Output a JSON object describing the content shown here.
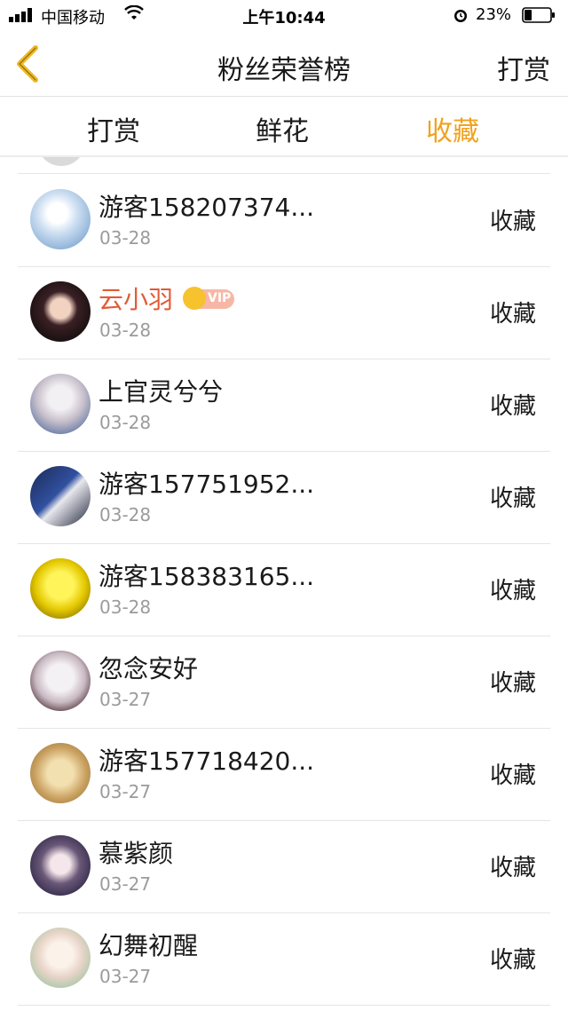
{
  "status_bar": {
    "carrier": "中国移动",
    "time": "上午10:44",
    "battery": "23%"
  },
  "nav": {
    "title": "粉丝荣誉榜",
    "right_action": "打赏",
    "back_icon": "chevron-left-icon"
  },
  "tabs": [
    {
      "label": "打赏",
      "active": false
    },
    {
      "label": "鲜花",
      "active": false
    },
    {
      "label": "收藏",
      "active": true
    }
  ],
  "colors": {
    "accent": "#f0a21e",
    "vip_name": "#e35a36",
    "secondary_text": "#9b9b9b"
  },
  "rows": [
    {
      "name": "游客158207374...",
      "date": "03-28",
      "action": "收藏",
      "vip": false
    },
    {
      "name": "云小羽",
      "date": "03-28",
      "action": "收藏",
      "vip": true,
      "badge": "VIP"
    },
    {
      "name": "上官灵兮兮",
      "date": "03-28",
      "action": "收藏",
      "vip": false
    },
    {
      "name": "游客157751952...",
      "date": "03-28",
      "action": "收藏",
      "vip": false
    },
    {
      "name": "游客158383165...",
      "date": "03-28",
      "action": "收藏",
      "vip": false
    },
    {
      "name": "忽念安好",
      "date": "03-27",
      "action": "收藏",
      "vip": false
    },
    {
      "name": "游客157718420...",
      "date": "03-27",
      "action": "收藏",
      "vip": false
    },
    {
      "name": "慕紫颜",
      "date": "03-27",
      "action": "收藏",
      "vip": false
    },
    {
      "name": "幻舞初醒",
      "date": "03-27",
      "action": "收藏",
      "vip": false
    }
  ]
}
